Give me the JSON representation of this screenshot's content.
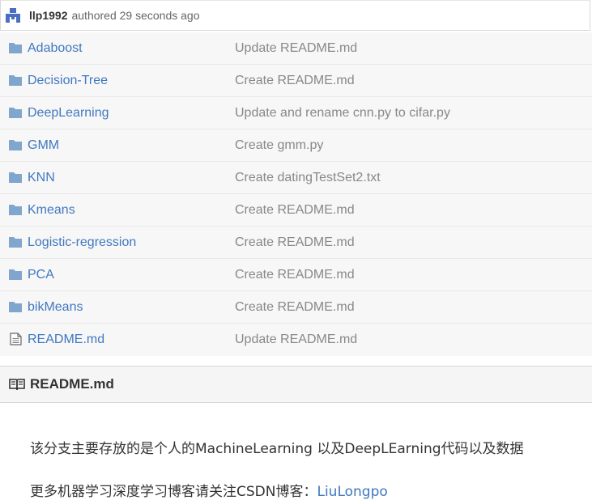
{
  "commit": {
    "author": "llp1992",
    "text": "authored 29 seconds ago"
  },
  "files": [
    {
      "type": "folder",
      "icon": "folder-icon",
      "name": "Adaboost",
      "message": "Update README.md"
    },
    {
      "type": "folder",
      "icon": "folder-icon",
      "name": "Decision-Tree",
      "message": "Create README.md"
    },
    {
      "type": "folder",
      "icon": "folder-icon",
      "name": "DeepLearning",
      "message": "Update and rename cnn.py to cifar.py"
    },
    {
      "type": "folder",
      "icon": "folder-icon",
      "name": "GMM",
      "message": "Create gmm.py"
    },
    {
      "type": "folder",
      "icon": "folder-icon",
      "name": "KNN",
      "message": "Create datingTestSet2.txt"
    },
    {
      "type": "folder",
      "icon": "folder-icon",
      "name": "Kmeans",
      "message": "Create README.md"
    },
    {
      "type": "folder",
      "icon": "folder-icon",
      "name": "Logistic-regression",
      "message": "Create README.md"
    },
    {
      "type": "folder",
      "icon": "folder-icon",
      "name": "PCA",
      "message": "Create README.md"
    },
    {
      "type": "folder",
      "icon": "folder-icon",
      "name": "bikMeans",
      "message": "Create README.md"
    },
    {
      "type": "file",
      "icon": "file-icon",
      "name": "README.md",
      "message": "Update README.md"
    }
  ],
  "readme": {
    "title": "README.md",
    "line1": "该分支主要存放的是个人的MachineLearning 以及DeepLEarning代码以及数据",
    "line2_prefix": "更多机器学习深度学习博客请关注CSDN博客：",
    "line2_link": "LiuLongpo"
  },
  "colors": {
    "link": "#4078c0",
    "folder": "#80a6cd",
    "muted": "#888888",
    "row_bg": "#f7f7f7"
  }
}
